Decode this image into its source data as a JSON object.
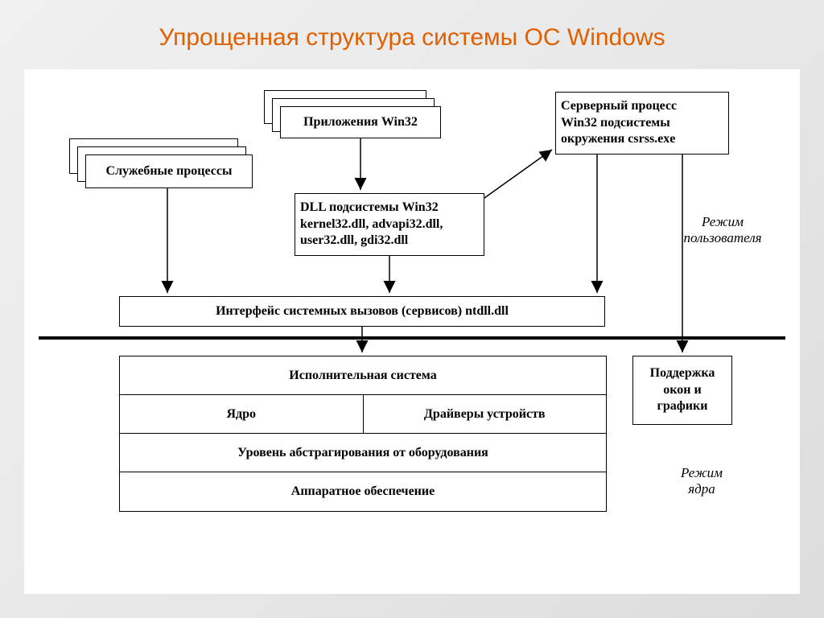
{
  "title": "Упрощенная структура системы ОС Windows",
  "boxes": {
    "service_processes": "Служебные процессы",
    "win32_apps": "Приложения Win32",
    "server_process_l1": "Серверный процесс",
    "server_process_l2": "Win32 подсистемы",
    "server_process_l3": "окружения  csrss.exe",
    "dll_l1": "DLL подсистемы Win32",
    "dll_l2": "kernel32.dll, advapi32.dll,",
    "dll_l3": "user32.dll, gdi32.dll",
    "syscall_interface": "Интерфейс системных вызовов (сервисов)  ntdll.dll",
    "window_support_l1": "Поддержка",
    "window_support_l2": "окон и",
    "window_support_l3": "графики"
  },
  "table": {
    "exec_system": "Исполнительная система",
    "kernel": "Ядро",
    "drivers": "Драйверы устройств",
    "hal": "Уровень абстрагирования от оборудования",
    "hardware": "Аппаратное обеспечение"
  },
  "labels": {
    "user_mode_l1": "Режим",
    "user_mode_l2": "пользователя",
    "kernel_mode_l1": "Режим",
    "kernel_mode_l2": "ядра"
  }
}
